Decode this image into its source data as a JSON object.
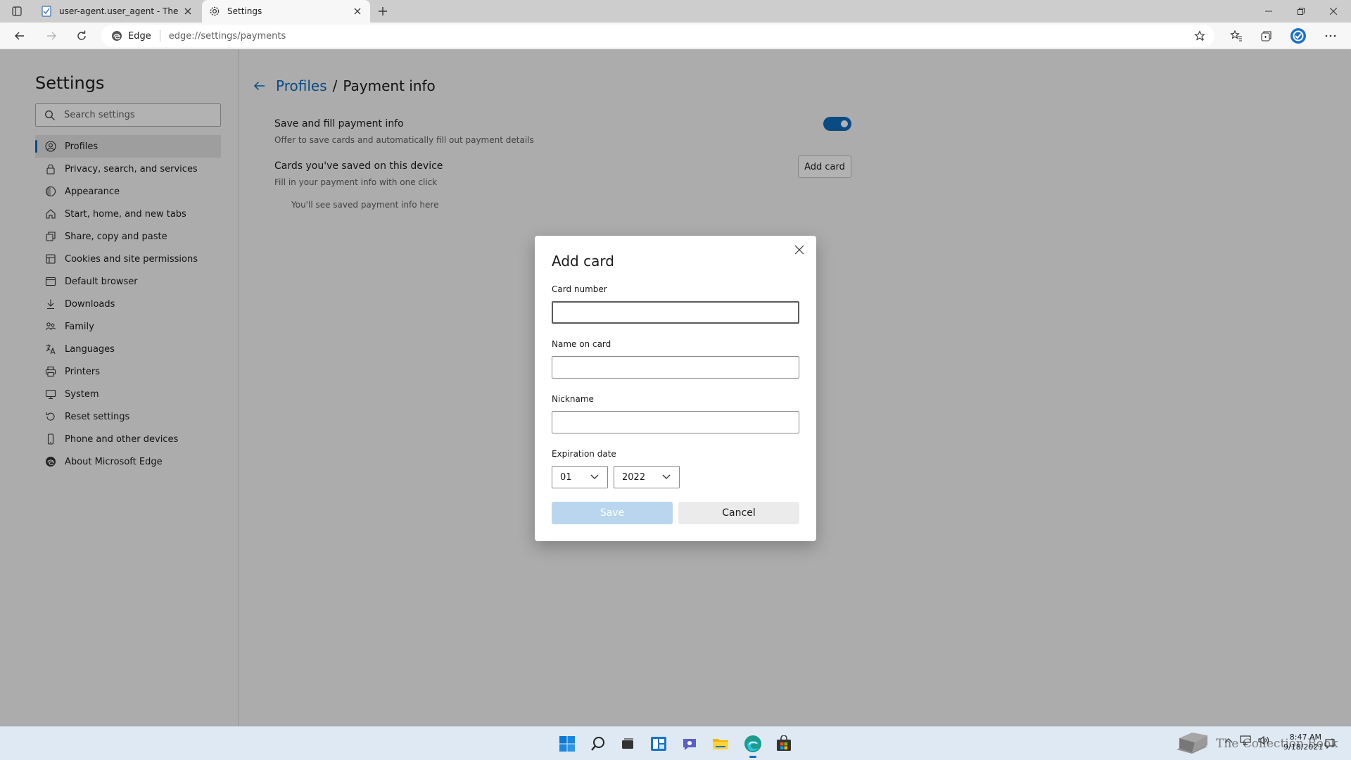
{
  "tabs": [
    {
      "title": "user-agent.user_agent - The Coll",
      "favicon": "document-icon"
    },
    {
      "title": "Settings",
      "favicon": "gear-icon"
    }
  ],
  "address": {
    "site": "Edge",
    "url": "edge://settings/payments"
  },
  "sidebar": {
    "title": "Settings",
    "search_placeholder": "Search settings",
    "items": [
      {
        "label": "Profiles",
        "icon": "profile-icon"
      },
      {
        "label": "Privacy, search, and services",
        "icon": "lock-icon"
      },
      {
        "label": "Appearance",
        "icon": "appearance-icon"
      },
      {
        "label": "Start, home, and new tabs",
        "icon": "home-icon"
      },
      {
        "label": "Share, copy and paste",
        "icon": "share-icon"
      },
      {
        "label": "Cookies and site permissions",
        "icon": "cookies-icon"
      },
      {
        "label": "Default browser",
        "icon": "browser-icon"
      },
      {
        "label": "Downloads",
        "icon": "download-icon"
      },
      {
        "label": "Family",
        "icon": "family-icon"
      },
      {
        "label": "Languages",
        "icon": "languages-icon"
      },
      {
        "label": "Printers",
        "icon": "printer-icon"
      },
      {
        "label": "System",
        "icon": "system-icon"
      },
      {
        "label": "Reset settings",
        "icon": "reset-icon"
      },
      {
        "label": "Phone and other devices",
        "icon": "phone-icon"
      },
      {
        "label": "About Microsoft Edge",
        "icon": "edge-icon"
      }
    ]
  },
  "main": {
    "breadcrumb_link": "Profiles",
    "breadcrumb_sep": "/",
    "breadcrumb_current": "Payment info",
    "save_fill_title": "Save and fill payment info",
    "save_fill_desc": "Offer to save cards and automatically fill out payment details",
    "save_fill_enabled": true,
    "cards_title": "Cards you've saved on this device",
    "cards_desc": "Fill in your payment info with one click",
    "add_card_label": "Add card",
    "empty_note": "You'll see saved payment info here"
  },
  "dialog": {
    "title": "Add card",
    "card_number_label": "Card number",
    "card_number_value": "",
    "name_label": "Name on card",
    "name_value": "",
    "nickname_label": "Nickname",
    "nickname_value": "",
    "expiration_label": "Expiration date",
    "month": "01",
    "year": "2022",
    "save_label": "Save",
    "cancel_label": "Cancel"
  },
  "taskbar": {
    "watermark": "The Collection Book",
    "time": "8:47 AM",
    "date": "9/18/2021"
  },
  "colors": {
    "accent": "#0f6cbd",
    "save_disabled": "#b9d6ee"
  }
}
